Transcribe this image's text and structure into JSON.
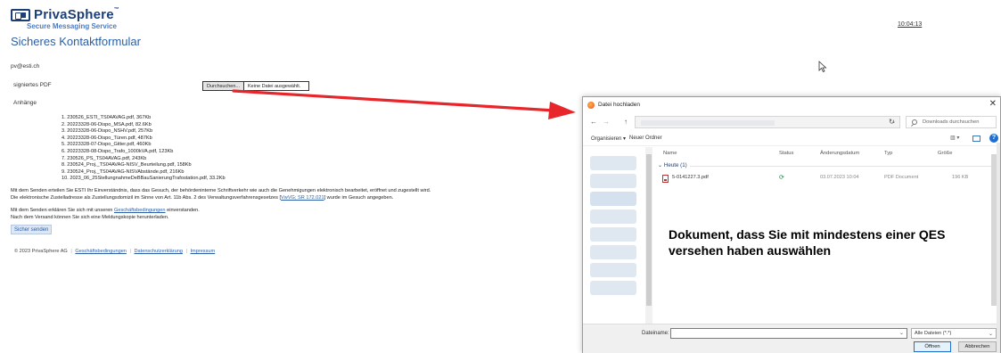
{
  "app": {
    "brand": "PrivaSphere",
    "brand_tm": "™",
    "tagline": "Secure Messaging Service",
    "clock": "10:04:13"
  },
  "form": {
    "title": "Sicheres Kontaktformular",
    "sender_email": "pv@esti.ch",
    "pdf_label": "signiertes PDF",
    "file_button": "Durchsuchen...",
    "file_status": "Keine Datei ausgewählt.",
    "attachments_label": "Anhänge",
    "attachments": [
      "1. 230526_ESTI_TS04AVAG.pdf, 367Kb",
      "2. 20223328-06-Dispo_MSA.pdf, 82.6Kb",
      "3. 20223328-06-Dispo_NSHV.pdf, 257Kb",
      "4. 20223328-06-Dispo_Türen.pdf, 487Kb",
      "5. 20223328-07-Dispo_Gitter.pdf, 460Kb",
      "6. 20223328-08-Dispo_Trafo_1000kVA.pdf, 123Kb",
      "7. 230526_PS_TS04AVAG.pdf, 243Kb",
      "8. 230524_Proj._TS04AVAG-NISV_Beurteilung.pdf, 158Kb",
      "9. 230524_Proj._TS04AVAG-NISVAbstände.pdf, 216Kb",
      "10. 2023_06_25StellungnahmeDeBBauSanierungTrafostation.pdf, 33.2Kb"
    ],
    "consent_line1": "Mit dem Senden erteilen Sie ESTI Ihr Einverständnis, dass das Gesuch, der behördeninterne Schriftverkehr wie auch die Genehmigungen elektronisch bearbeitet, eröffnet und zugestellt wird.",
    "consent_line2_pre": "Die elektronische Zustelladresse als Zustellungsdomizil im Sinne von Art. 11b Abs. 2 des Verwaltungsverfahrensgesetzes [",
    "consent_line2_link": "VwVG; SR 172.021",
    "consent_line2_post": "] wurde im Gesuch angegeben.",
    "terms_pre": "Mit dem Senden erklären Sie sich mit unseren ",
    "terms_link": "Geschäftsbedingungen",
    "terms_post": " einverstanden.",
    "receipt_note": "Nach dem Versand können Sie sich eine Meldungskopie herunterladen.",
    "send_button": "Sicher senden"
  },
  "footer": {
    "copyright": "© 2023 PrivaSphere AG",
    "links": [
      "Geschäftsbedingungen",
      "Datenschutzerklärung",
      "Impressum"
    ],
    "separator": "|"
  },
  "dialog": {
    "title": "Datei hochladen",
    "close": "✕",
    "nav_back": "←",
    "nav_forward": "→",
    "nav_up": "↑",
    "refresh": "↻",
    "search_placeholder": "Downloads durchsuchen",
    "organize": "Organisieren ▾",
    "new_folder": "Neuer Ordner",
    "view_control": "▥ ▾",
    "help": "?",
    "columns": {
      "name": "Name",
      "status": "Status",
      "date": "Änderungsdatum",
      "type": "Typ",
      "size": "Größe"
    },
    "group": "Heute (1)",
    "file": {
      "name": "5-0141227.3.pdf",
      "date": "03.07.2023 10:04",
      "type": "PDF Document",
      "size": "196 KB"
    },
    "filename_label": "Dateiname:",
    "file_type": "Alle Dateien (*.*)",
    "open_button": "Öffnen",
    "cancel_button": "Abbrechen"
  },
  "annotation": {
    "text": "Dokument, dass Sie mit mindestens einer QES versehen haben auswählen",
    "arrow_color": "#e8252b"
  },
  "colors": {
    "brand": "#1c3f78",
    "link": "#2a5fa8",
    "accent": "#1f6fd1"
  }
}
